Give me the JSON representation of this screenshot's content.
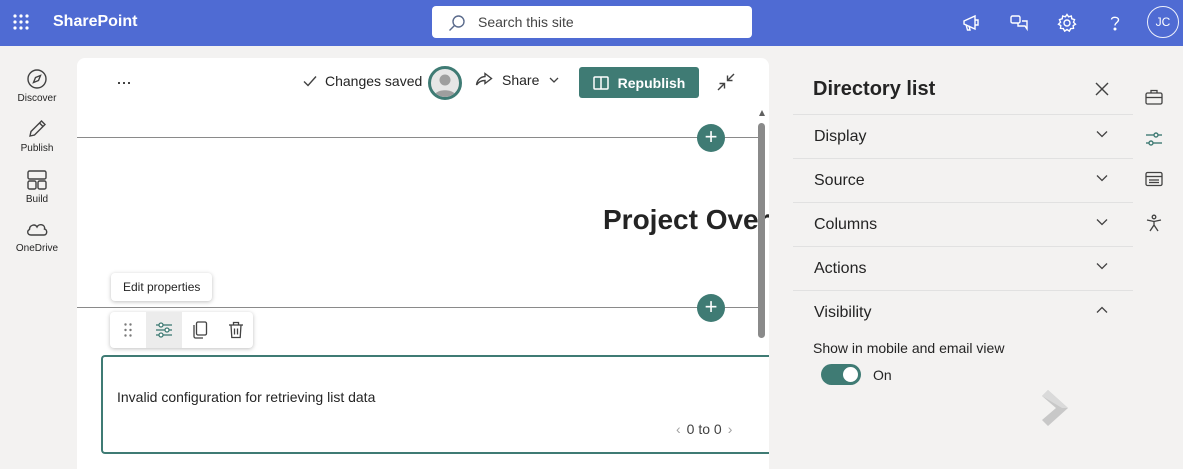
{
  "app": {
    "name": "SharePoint"
  },
  "search": {
    "placeholder": "Search this site"
  },
  "user": {
    "initials": "JC"
  },
  "left_rail": [
    {
      "label": "Discover",
      "icon": "compass-icon"
    },
    {
      "label": "Publish",
      "icon": "pen-icon"
    },
    {
      "label": "Build",
      "icon": "build-icon"
    },
    {
      "label": "OneDrive",
      "icon": "cloud-icon"
    }
  ],
  "toolbar": {
    "more_label": "...",
    "status": "Changes saved",
    "share_label": "Share",
    "republish_label": "Republish"
  },
  "page": {
    "title": "Project Over"
  },
  "webpart_toolbar": {
    "tooltip": "Edit properties"
  },
  "webpart": {
    "error_text": "Invalid configuration for retrieving list data",
    "pager_text": "0 to 0",
    "prev": "‹",
    "next": "›"
  },
  "panel": {
    "title": "Directory list",
    "sections": [
      {
        "label": "Display",
        "expanded": false
      },
      {
        "label": "Source",
        "expanded": false
      },
      {
        "label": "Columns",
        "expanded": false
      },
      {
        "label": "Actions",
        "expanded": false
      },
      {
        "label": "Visibility",
        "expanded": true
      }
    ],
    "visibility": {
      "option_label": "Show in mobile and email view",
      "toggle_state": "On",
      "toggle_on": true
    }
  },
  "colors": {
    "suite_bar": "#4f6bd3",
    "accent": "#3f7b74"
  }
}
